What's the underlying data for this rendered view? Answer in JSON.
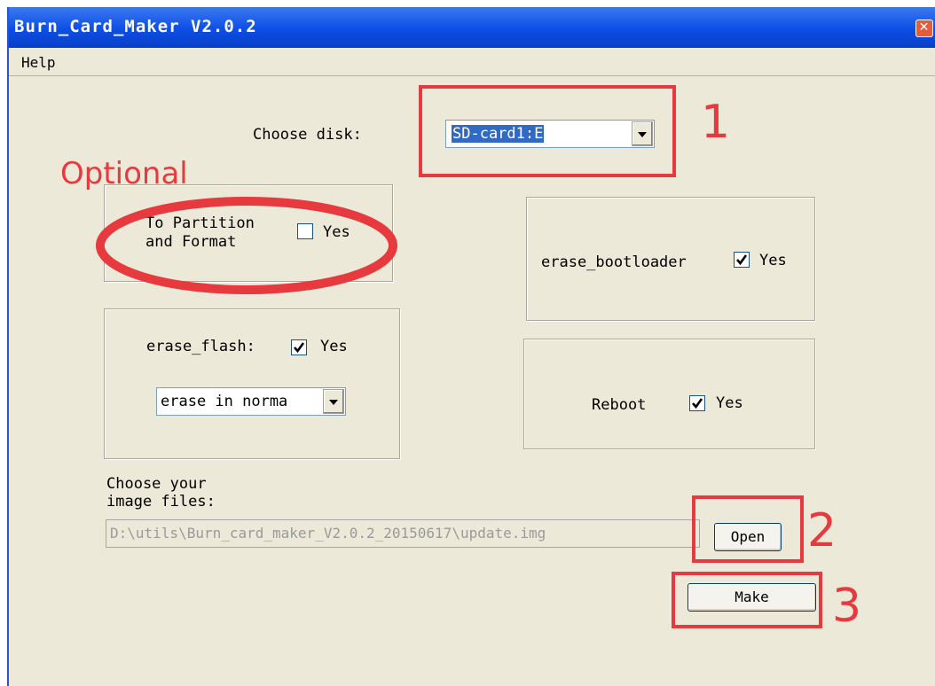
{
  "window": {
    "title": "Burn_Card_Maker V2.0.2",
    "close_glyph": "✕"
  },
  "menu": {
    "help": "Help"
  },
  "disk": {
    "label": "Choose disk:",
    "selected": "SD-card1:E"
  },
  "partition": {
    "label_line1": "To Partition",
    "label_line2": "and Format",
    "checked": false,
    "yes": "Yes"
  },
  "erase_bootloader": {
    "label": "erase_bootloader",
    "checked": true,
    "yes": "Yes"
  },
  "erase_flash": {
    "label": "erase_flash:",
    "checked": true,
    "yes": "Yes",
    "mode_selected": "erase in norma"
  },
  "reboot": {
    "label": "Reboot",
    "checked": true,
    "yes": "Yes"
  },
  "image": {
    "label_line1": "Choose your",
    "label_line2": "image files:",
    "path": "D:\\utils\\Burn_card_maker_V2.0.2_20150617\\update.img",
    "open_button": "Open",
    "make_button": "Make"
  },
  "annotations": {
    "optional": "Optional",
    "step1": "1",
    "step2": "2",
    "step3": "3",
    "color": "#e63a3f"
  },
  "icons": {
    "checkmark": "checkmark-icon",
    "dropdown": "chevron-down-icon",
    "close": "close-icon"
  }
}
